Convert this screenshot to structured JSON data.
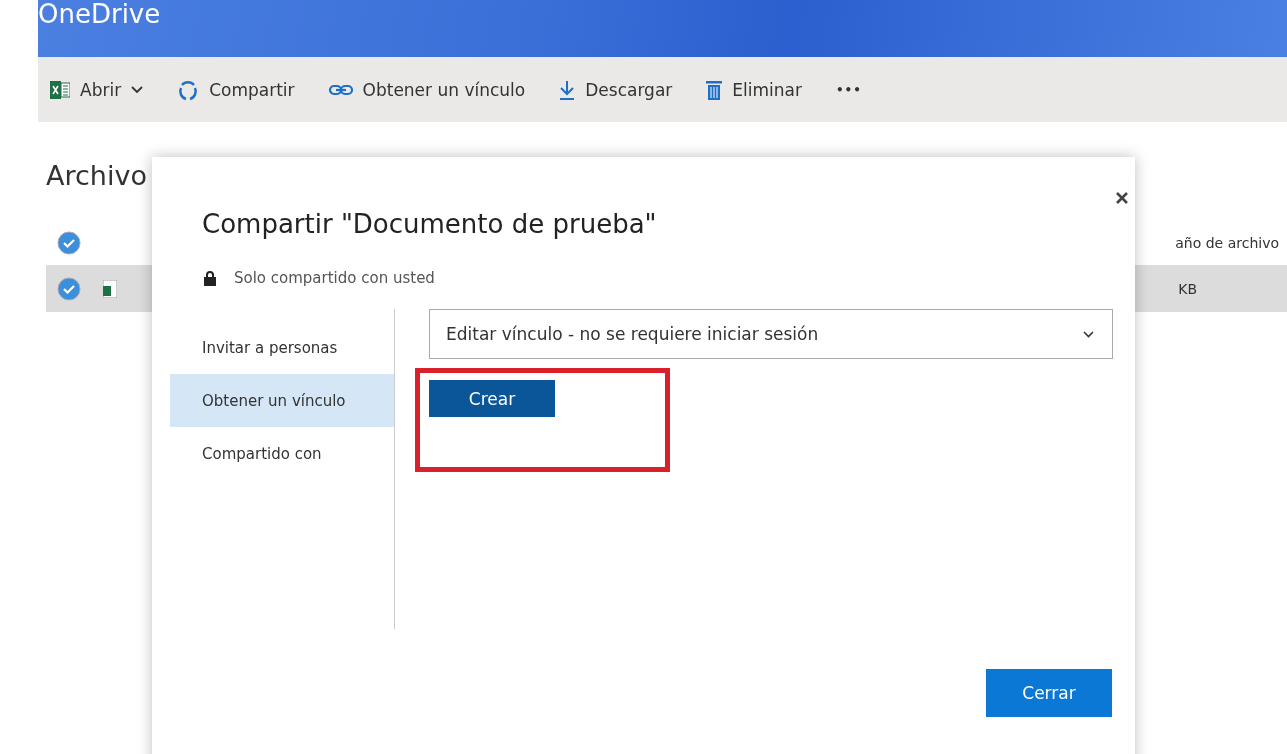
{
  "header": {
    "title": "OneDrive"
  },
  "toolbar": [
    {
      "kind": "excel",
      "label": "Abrir"
    },
    {
      "kind": "share",
      "label": "Compartir"
    },
    {
      "kind": "link",
      "label": "Obtener un vínculo"
    },
    {
      "kind": "download",
      "label": "Descargar"
    },
    {
      "kind": "trash",
      "label": "Eliminar"
    },
    {
      "kind": "more",
      "label": "•••"
    }
  ],
  "files": {
    "heading": "Archivo",
    "select_all": {
      "checked": true
    },
    "column": "año de archivo",
    "rows": [
      {
        "checked": true,
        "selected": true,
        "size": "KB"
      }
    ]
  },
  "dialog": {
    "title": "Compartir \"Documento de prueba\"",
    "privacy": "Solo compartido con usted",
    "nav": [
      {
        "label": "Invitar a personas",
        "selected": false
      },
      {
        "label": "Obtener un vínculo",
        "selected": true
      },
      {
        "label": "Compartido con",
        "selected": false
      }
    ],
    "link_type": "Editar vínculo - no se requiere iniciar sesión",
    "create_button": "Crear",
    "close_button": "Cerrar"
  }
}
